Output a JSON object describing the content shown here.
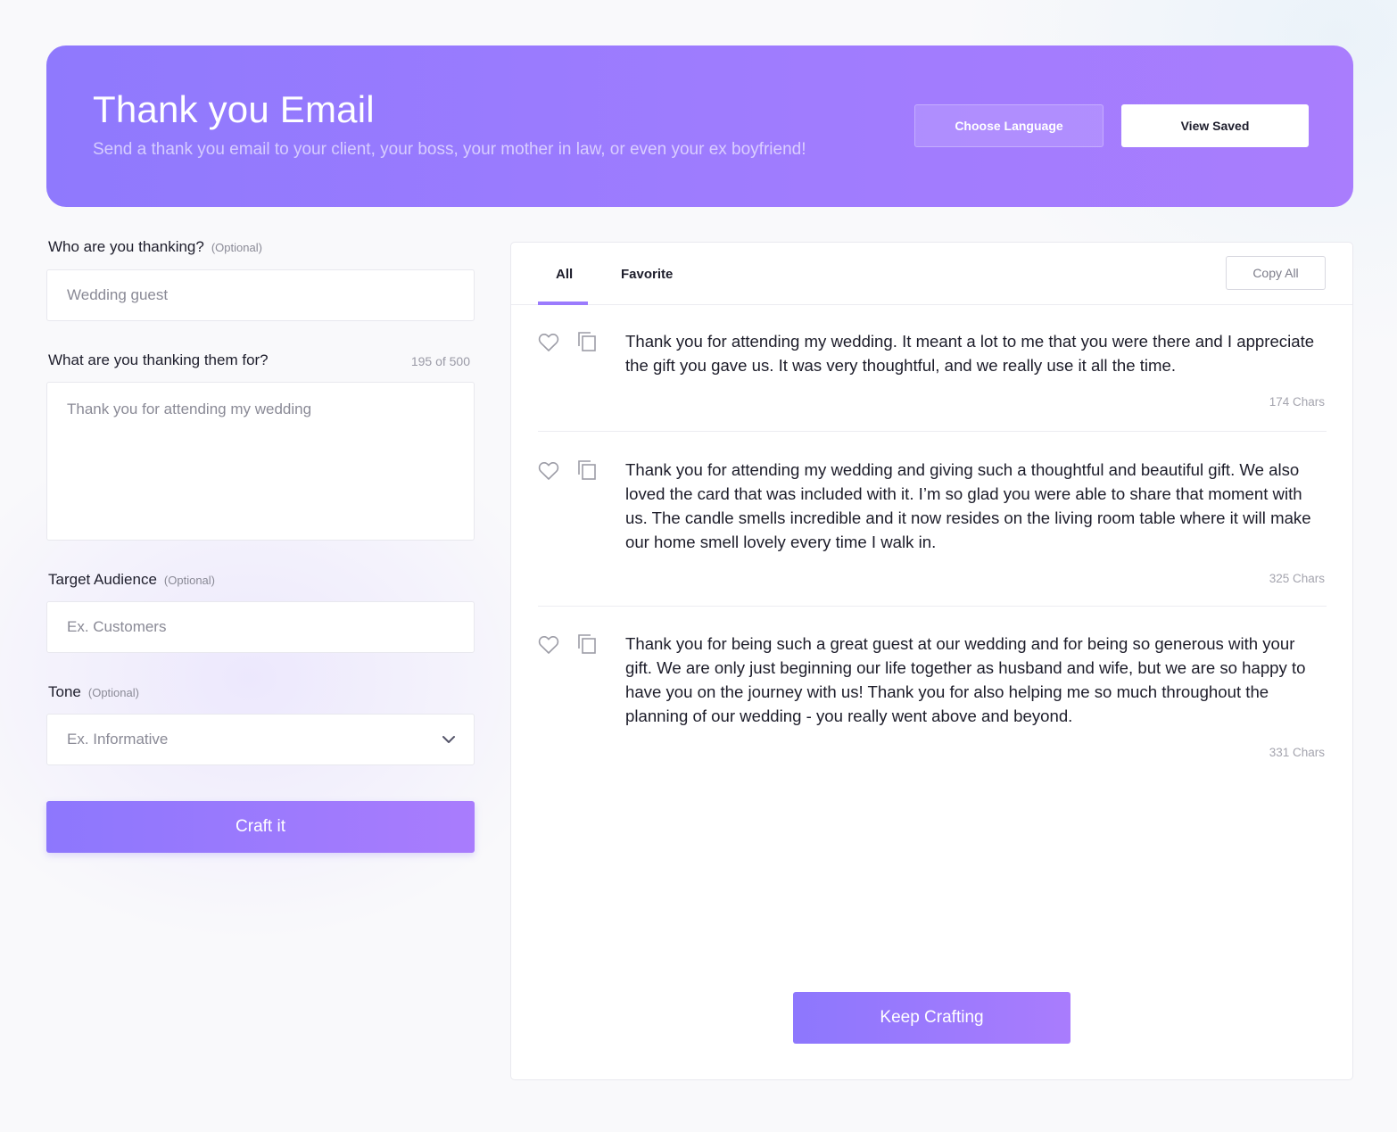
{
  "header": {
    "title": "Thank you Email",
    "subtitle": "Send a thank you email to your client, your boss, your mother in law, or even your ex boyfriend!",
    "language_button": "Choose Language",
    "saved_button": "View Saved"
  },
  "form": {
    "who": {
      "label": "Who are you thanking?",
      "optional": "(Optional)",
      "placeholder": "Wedding guest"
    },
    "what": {
      "label": "What are you thanking them for?",
      "counter": "195 of 500",
      "value": "Thank you for attending my wedding"
    },
    "audience": {
      "label": "Target Audience",
      "optional": "(Optional)",
      "placeholder": "Ex. Customers"
    },
    "tone": {
      "label": "Tone",
      "optional": "(Optional)",
      "placeholder": "Ex. Informative",
      "icon": "chevron-down-icon"
    },
    "submit_label": "Craft it"
  },
  "results": {
    "tabs": [
      {
        "label": "All",
        "active": true
      },
      {
        "label": "Favorite",
        "active": false
      }
    ],
    "copy_all_label": "Copy All",
    "items": [
      {
        "text": "Thank you for attending my wedding. It meant a lot to me that you were there and I appreciate the gift you gave us. It was very thoughtful, and we really use it all the time.",
        "chars": "174 Chars"
      },
      {
        "text": "Thank you for attending my wedding and giving such a thoughtful and beautiful gift. We also loved the card that was included with it. I’m so glad you were able to share that moment with us. The candle smells incredible and it now resides on the living room table where it will make our home smell lovely every time I walk in.",
        "chars": "325 Chars"
      },
      {
        "text": "Thank you for being such a great guest at our wedding and for being so generous with your gift. We are only just beginning our life together as husband and wife, but we are so happy to have you on the journey with us! Thank you for also helping me so much throughout the planning of our wedding - you really went above and beyond.",
        "chars": "331 Chars"
      }
    ],
    "keep_label": "Keep Crafting"
  },
  "colors": {
    "accent": "#9b7bfd",
    "hero_start": "#8f79fd",
    "hero_end": "#a97dfd"
  }
}
